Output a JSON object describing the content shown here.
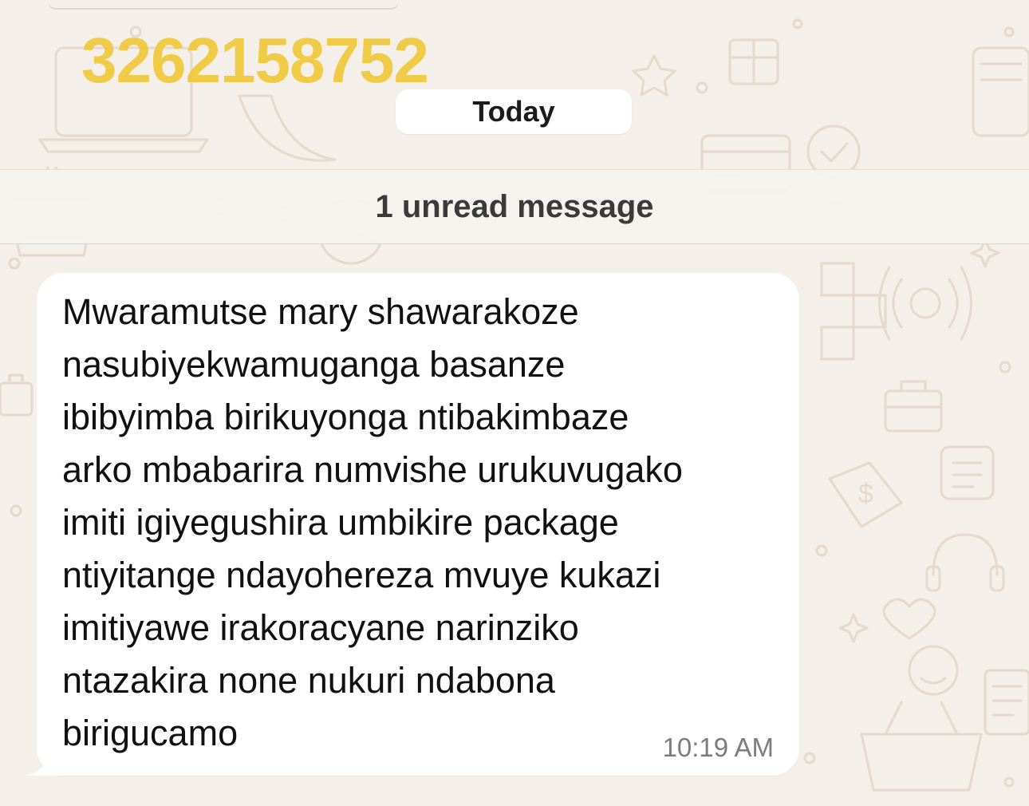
{
  "overlay": {
    "number": "3262158752"
  },
  "chat": {
    "date_label": "Today",
    "unread_label": "1 unread message"
  },
  "message": {
    "text": "Mwaramutse mary shawarakoze\nnasubiyekwamuganga basanze\nibibyimba birikuyonga ntibakimbaze\narko mbabarira numvishe urukuvugako\nimiti igiyegushira umbikire package\nntiyitange ndayohereza mvuye kukazi\nimitiyawe irakoracyane narinziko\nntazakira none nukuri ndabona\nbirigucamo",
    "time": "10:19 AM"
  },
  "colors": {
    "wallpaper": "#f4efe8",
    "bubble": "#ffffff",
    "overlay_number": "#f0c93a",
    "doodle": "#e6ddd1"
  }
}
